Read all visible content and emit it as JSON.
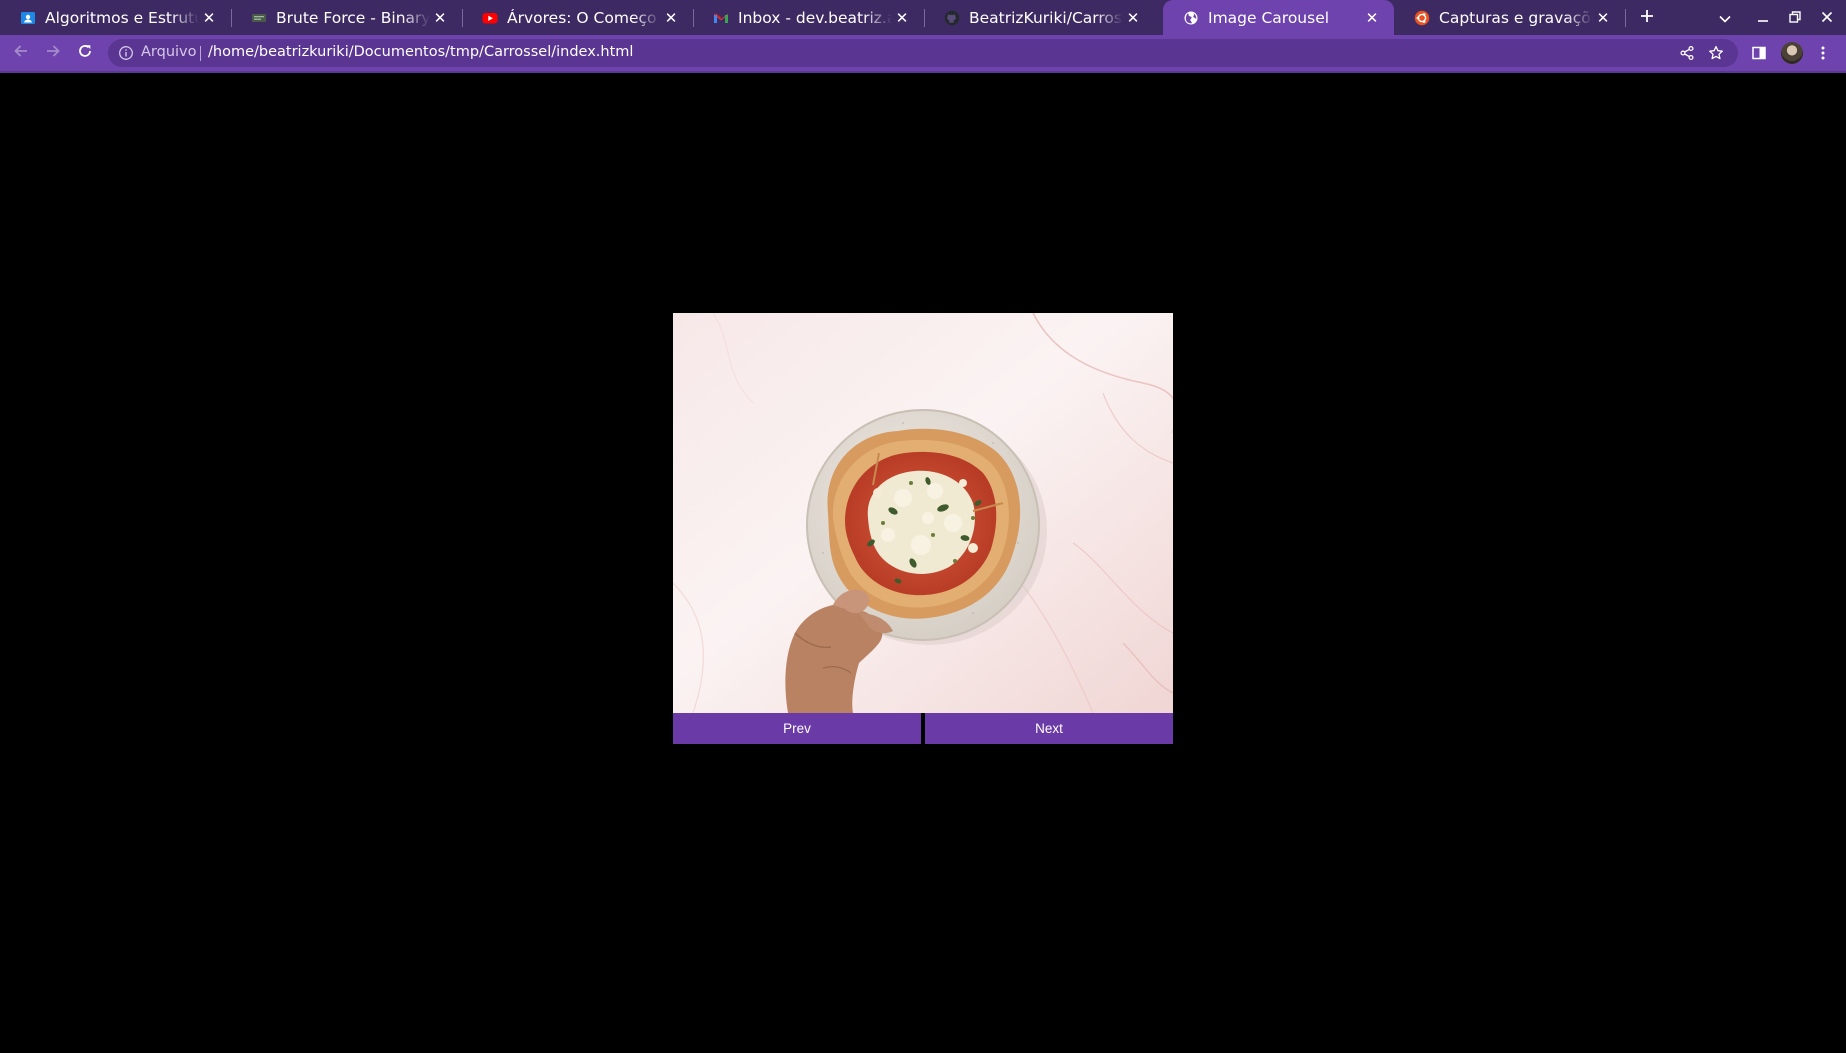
{
  "browser": {
    "tabs": [
      {
        "title": "Algoritmos e Estrutura d",
        "icon": "classroom-icon",
        "active": false
      },
      {
        "title": "Brute Force - Binary Tree",
        "icon": "terminal-icon",
        "active": false
      },
      {
        "title": "Árvores: O Começo de TU",
        "icon": "youtube-icon",
        "active": false
      },
      {
        "title": "Inbox - dev.beatriz.alenc",
        "icon": "gmail-icon",
        "active": false
      },
      {
        "title": "BeatrizKuriki/Carrossel:",
        "icon": "github-icon",
        "active": false
      },
      {
        "title": "Image Carousel",
        "icon": "globe-icon",
        "active": true
      },
      {
        "title": "Capturas e gravações de",
        "icon": "ubuntu-icon",
        "active": false
      }
    ],
    "omnibox": {
      "label": "Arquivo",
      "url": "/home/beatrizkuriki/Documentos/tmp/Carrossel/index.html"
    },
    "colors": {
      "tabstrip": "#3d2a63",
      "toolbar": "#6e43ad",
      "omnibox": "#5a3591"
    }
  },
  "carousel": {
    "image": {
      "subject": "pizza-on-plate-image",
      "colors": {
        "background": "#f4e4e4",
        "plate": "#e6e1da",
        "crust": "#d79b5f",
        "sauce": "#c4432c",
        "cheese": "#f1ead3",
        "basil": "#3f5a2c",
        "hand": "#b98262"
      }
    },
    "prev_label": "Prev",
    "next_label": "Next",
    "button_color": "#6a3aa6"
  },
  "page": {
    "background": "#000000"
  }
}
